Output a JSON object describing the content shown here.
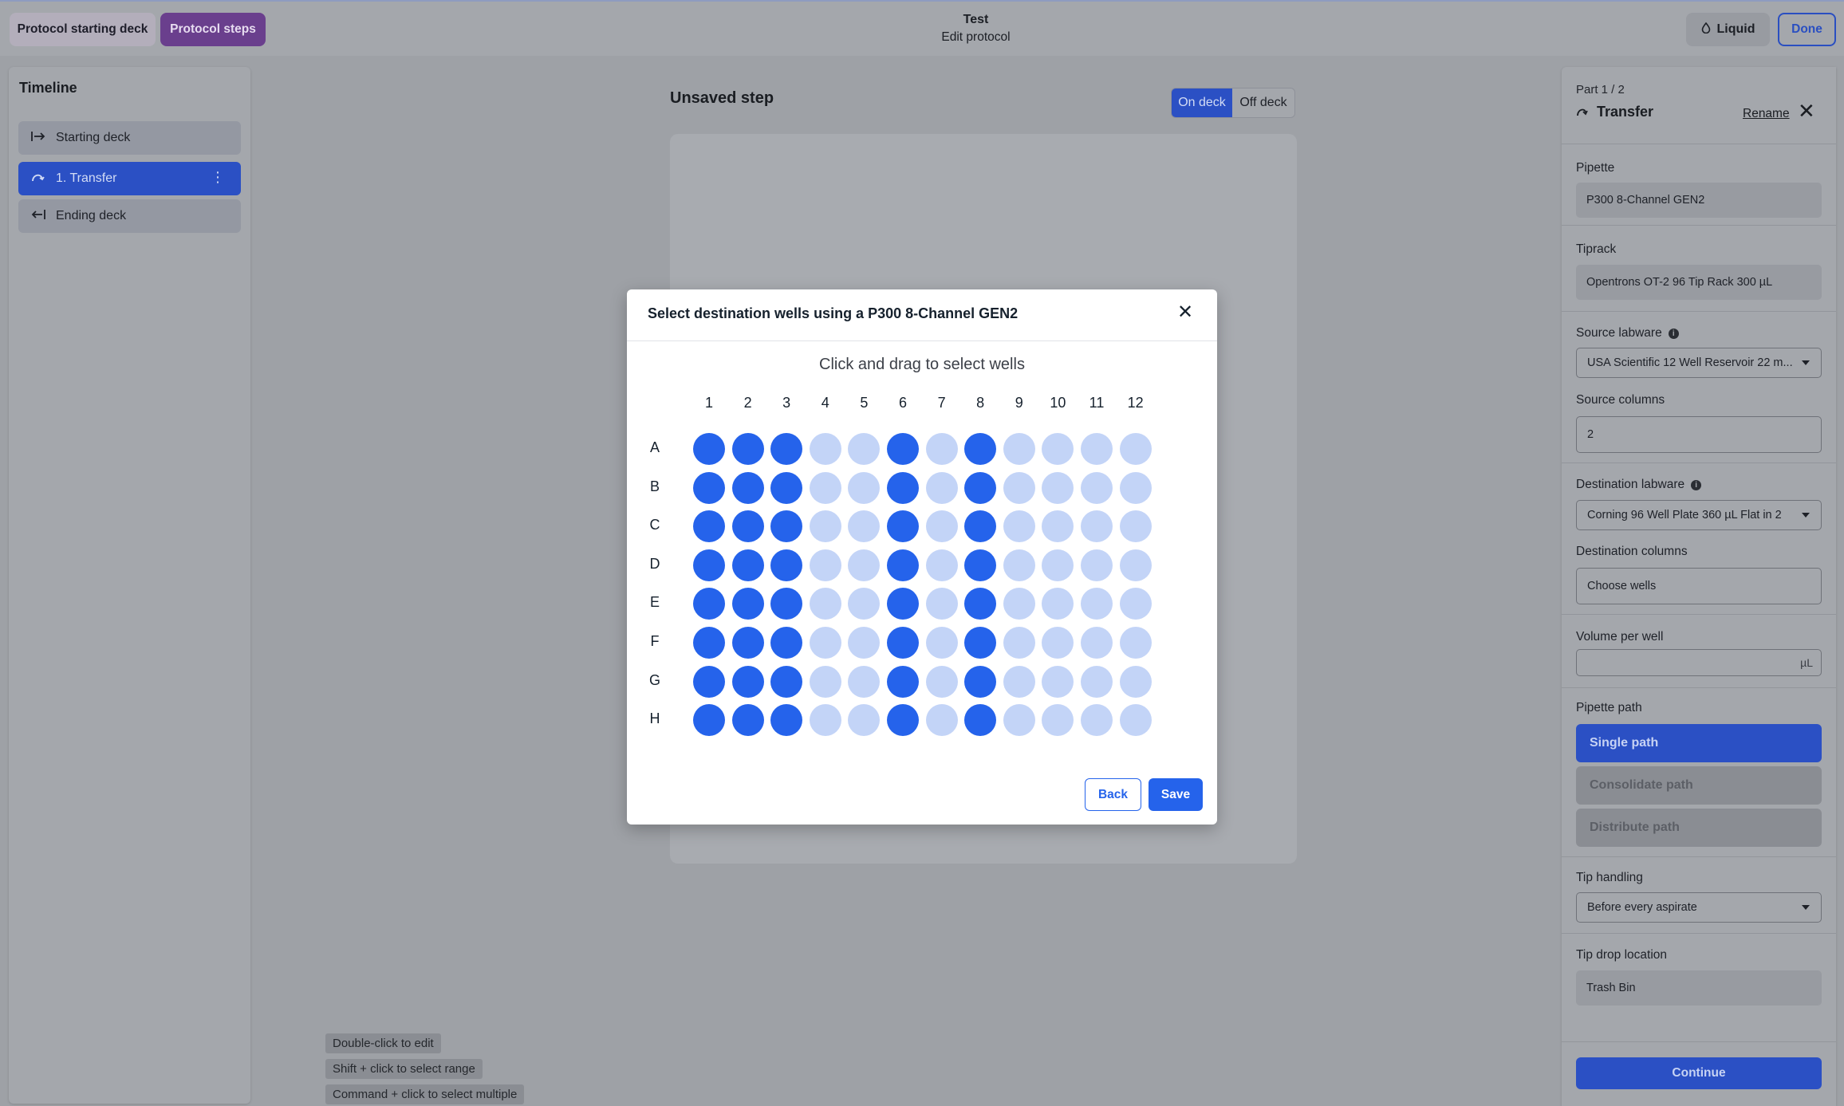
{
  "topbar": {
    "tab_starting_deck": "Protocol starting deck",
    "tab_protocol_steps": "Protocol steps",
    "title": "Test",
    "subtitle": "Edit protocol",
    "liquid_label": "Liquid",
    "done_label": "Done"
  },
  "timeline": {
    "title": "Timeline",
    "items": [
      {
        "label": "Starting deck",
        "icon": "arrow-right-to-bar-icon"
      },
      {
        "label": "1. Transfer",
        "icon": "transfer-curve-icon"
      },
      {
        "label": "Ending deck",
        "icon": "arrow-left-from-bar-icon"
      }
    ]
  },
  "center": {
    "step_title": "Unsaved step",
    "toggle_on": "On deck",
    "toggle_off": "Off deck"
  },
  "hints": [
    "Double-click to edit",
    "Shift + click to select range",
    "Command + click to select multiple"
  ],
  "modal": {
    "title": "Select destination wells using a P300 8-Channel GEN2",
    "instruction": "Click and drag to select wells",
    "columns": [
      "1",
      "2",
      "3",
      "4",
      "5",
      "6",
      "7",
      "8",
      "9",
      "10",
      "11",
      "12"
    ],
    "rows": [
      "A",
      "B",
      "C",
      "D",
      "E",
      "F",
      "G",
      "H"
    ],
    "selected_columns": [
      "1",
      "2",
      "3",
      "6",
      "8"
    ],
    "back_label": "Back",
    "save_label": "Save",
    "colors": {
      "selected": "#2563eb",
      "unselected": "#c3d4f7"
    }
  },
  "panel": {
    "part": "Part 1 / 2",
    "step_name": "Transfer",
    "rename": "Rename",
    "pipette_label": "Pipette",
    "pipette_value": "P300 8-Channel GEN2",
    "tiprack_label": "Tiprack",
    "tiprack_value": "Opentrons OT-2 96 Tip Rack 300 µL",
    "source_labware_label": "Source labware",
    "source_labware_value": "USA Scientific 12 Well Reservoir 22 m...",
    "source_columns_label": "Source columns",
    "source_columns_value": "2",
    "dest_labware_label": "Destination labware",
    "dest_labware_value": "Corning 96 Well Plate 360 µL Flat in 2",
    "dest_columns_label": "Destination columns",
    "dest_columns_value": "Choose wells",
    "volume_label": "Volume per well",
    "volume_unit": "µL",
    "pipette_path_label": "Pipette path",
    "path_single": "Single path",
    "path_consolidate": "Consolidate path",
    "path_distribute": "Distribute path",
    "tip_handling_label": "Tip handling",
    "tip_handling_value": "Before every aspirate",
    "tip_drop_label": "Tip drop location",
    "tip_drop_value": "Trash Bin",
    "continue_label": "Continue"
  }
}
